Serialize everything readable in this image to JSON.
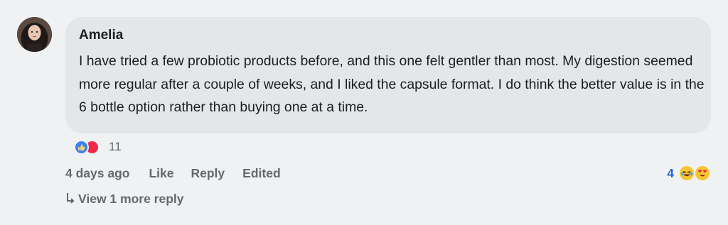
{
  "comment": {
    "author": "Amelia",
    "text": "I have tried a few probiotic products before, and this one felt gentler than most. My digestion seemed more regular after a couple of weeks, and I liked the capsule format. I do think the better value is in the 6 bottle option rather than buying one at a time.",
    "reaction_count": "11",
    "reaction_icons": [
      "like-icon",
      "love-icon"
    ]
  },
  "actions": {
    "timestamp": "4 days ago",
    "like_label": "Like",
    "reply_label": "Reply",
    "edited_label": "Edited"
  },
  "replies": {
    "reaction_count": "4",
    "reaction_icons": [
      "laughing-emoji-icon",
      "heart-eyes-emoji-icon"
    ],
    "view_more_label": "View 1 more reply"
  },
  "colors": {
    "background": "#f0f1f3",
    "bubble": "#e4e6ea",
    "link_blue": "#1e63d6",
    "muted_text": "#65676b"
  }
}
